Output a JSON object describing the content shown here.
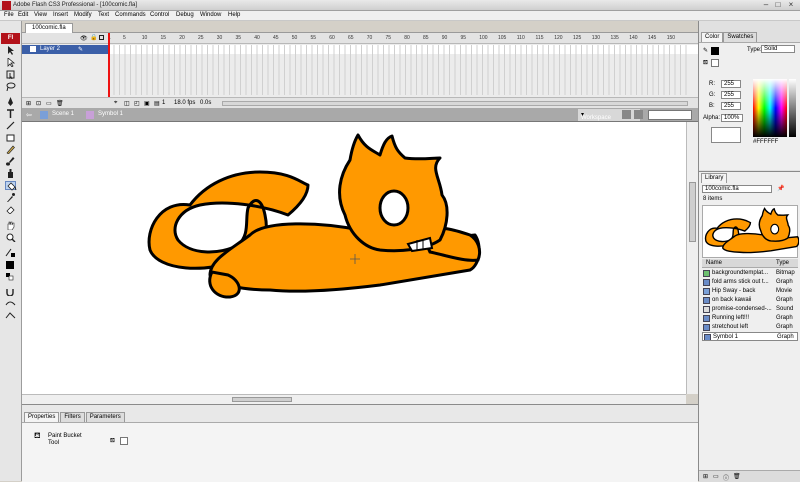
{
  "window": {
    "title": "Adobe Flash CS3 Professional - [100comic.fla]",
    "controls": [
      "–",
      "□",
      "×"
    ]
  },
  "menu": [
    "File",
    "Edit",
    "View",
    "Insert",
    "Modify",
    "Text",
    "Commands",
    "Control",
    "Debug",
    "Window",
    "Help"
  ],
  "tools": {
    "logo": "Fl",
    "items": [
      "selection-tool",
      "subselection-tool",
      "free-transform-tool",
      "lasso-tool",
      "pen-tool",
      "text-tool",
      "line-tool",
      "rectangle-tool",
      "pencil-tool",
      "brush-tool",
      "ink-bottle-tool",
      "paint-bucket-tool",
      "eyedropper-tool",
      "eraser-tool",
      "hand-tool",
      "zoom-tool",
      "stroke-color",
      "fill-color",
      "swap-colors",
      "snap-tool",
      "smooth-tool",
      "straighten-tool"
    ]
  },
  "document": {
    "tab": "100comic.fla"
  },
  "timeline": {
    "ruler": [
      "1",
      "5",
      "10",
      "15",
      "20",
      "25",
      "30",
      "35",
      "40",
      "45",
      "50",
      "55",
      "60",
      "65",
      "70",
      "75",
      "80",
      "85",
      "90",
      "95",
      "100",
      "105",
      "110",
      "115",
      "120",
      "125",
      "130",
      "135",
      "140",
      "145",
      "150"
    ],
    "layer": "Layer 2",
    "current_frame": "1",
    "fps": "18.0 fps",
    "time": "0.0s"
  },
  "editbar": {
    "scene": "Scene 1",
    "symbol": "Symbol 1",
    "workspace": "Workspace",
    "zoom": "100%"
  },
  "properties": {
    "tabs": [
      "Properties",
      "Filters",
      "Parameters"
    ],
    "tool_name_line1": "Paint Bucket",
    "tool_name_line2": "Tool"
  },
  "color_panel": {
    "tabs": [
      "Color",
      "Swatches"
    ],
    "type_label": "Type:",
    "type_value": "Solid",
    "r_label": "R:",
    "r_value": "255",
    "g_label": "G:",
    "g_value": "255",
    "b_label": "B:",
    "b_value": "255",
    "alpha_label": "Alpha:",
    "alpha_value": "100%",
    "hex": "#FFFFFF"
  },
  "library": {
    "tab": "Library",
    "doc": "100comic.fla",
    "count": "8 items",
    "name_header": "Name",
    "type_header": "Type",
    "items": [
      {
        "name": "backgroundtemplat...",
        "type": "Bitmap"
      },
      {
        "name": "fold arms stick out t...",
        "type": "Graph"
      },
      {
        "name": "Hip Sway - back",
        "type": "Movie"
      },
      {
        "name": "on back kawaii",
        "type": "Graph"
      },
      {
        "name": "promise-condensed-...",
        "type": "Sound"
      },
      {
        "name": "Running left!!!",
        "type": "Graph"
      },
      {
        "name": "stretchout left",
        "type": "Graph"
      },
      {
        "name": "Symbol 1",
        "type": "Graph"
      }
    ]
  },
  "colors": {
    "cat_fill": "#ff9900",
    "outline": "#000000",
    "accent_red": "#b3121a"
  }
}
